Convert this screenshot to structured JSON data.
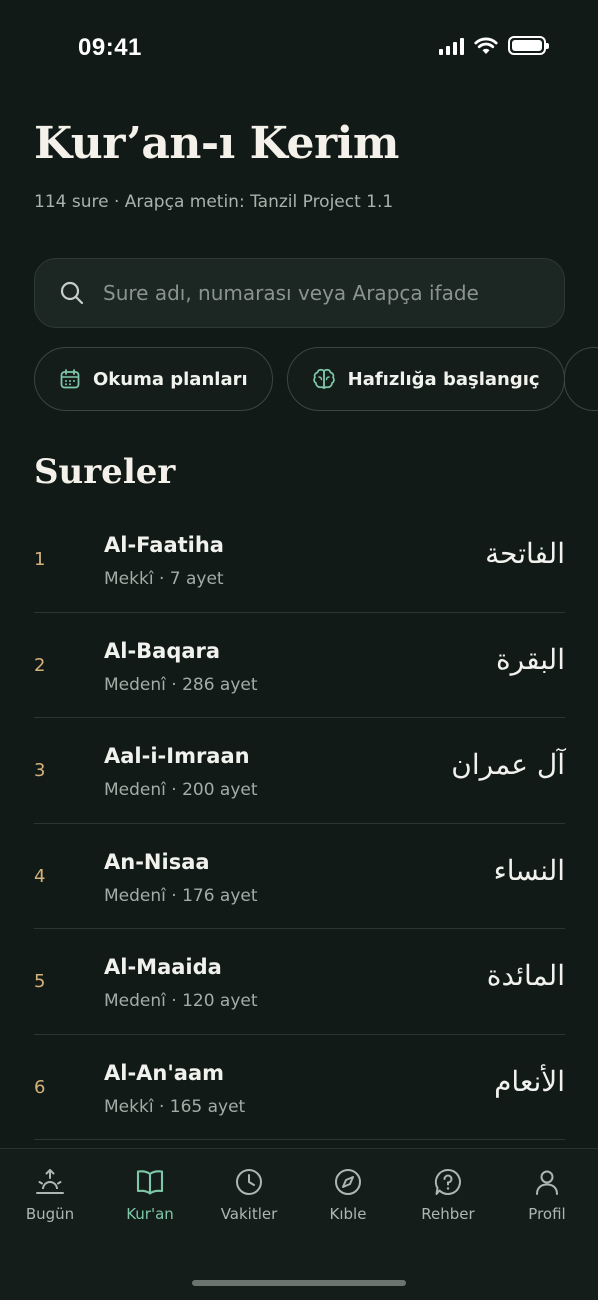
{
  "status": {
    "time": "09:41"
  },
  "header": {
    "title": "Kur’an-ı Kerim",
    "subtitle": "114 sure · Arapça metin: Tanzil Project 1.1"
  },
  "search": {
    "placeholder": "Sure adı, numarası veya Arapça ifade",
    "value": ""
  },
  "chips": [
    {
      "label": "Okuma planları",
      "icon": "calendar-icon"
    },
    {
      "label": "Hafızlığa başlangıç",
      "icon": "brain-icon"
    }
  ],
  "section": {
    "title": "Sureler"
  },
  "surahs": [
    {
      "number": "1",
      "name": "Al-Faatiha",
      "meta": "Mekkî · 7 ayet",
      "arabic": "الفاتحة"
    },
    {
      "number": "2",
      "name": "Al-Baqara",
      "meta": "Medenî · 286 ayet",
      "arabic": "البقرة"
    },
    {
      "number": "3",
      "name": "Aal-i-Imraan",
      "meta": "Medenî · 200 ayet",
      "arabic": "آل عمران"
    },
    {
      "number": "4",
      "name": "An-Nisaa",
      "meta": "Medenî · 176 ayet",
      "arabic": "النساء"
    },
    {
      "number": "5",
      "name": "Al-Maaida",
      "meta": "Medenî · 120 ayet",
      "arabic": "المائدة"
    },
    {
      "number": "6",
      "name": "Al-An'aam",
      "meta": "Mekkî · 165 ayet",
      "arabic": "الأنعام"
    }
  ],
  "tabs": [
    {
      "label": "Bugün",
      "icon": "sunrise-icon",
      "active": false
    },
    {
      "label": "Kur'an",
      "icon": "book-icon",
      "active": true
    },
    {
      "label": "Vakitler",
      "icon": "clock-icon",
      "active": false
    },
    {
      "label": "Kıble",
      "icon": "compass-icon",
      "active": false
    },
    {
      "label": "Rehber",
      "icon": "help-icon",
      "active": false
    },
    {
      "label": "Profil",
      "icon": "user-icon",
      "active": false
    }
  ],
  "colors": {
    "background": "#121a17",
    "accent": "#7fc7a8",
    "number": "#d6b27a",
    "muted": "#a3aca7"
  }
}
